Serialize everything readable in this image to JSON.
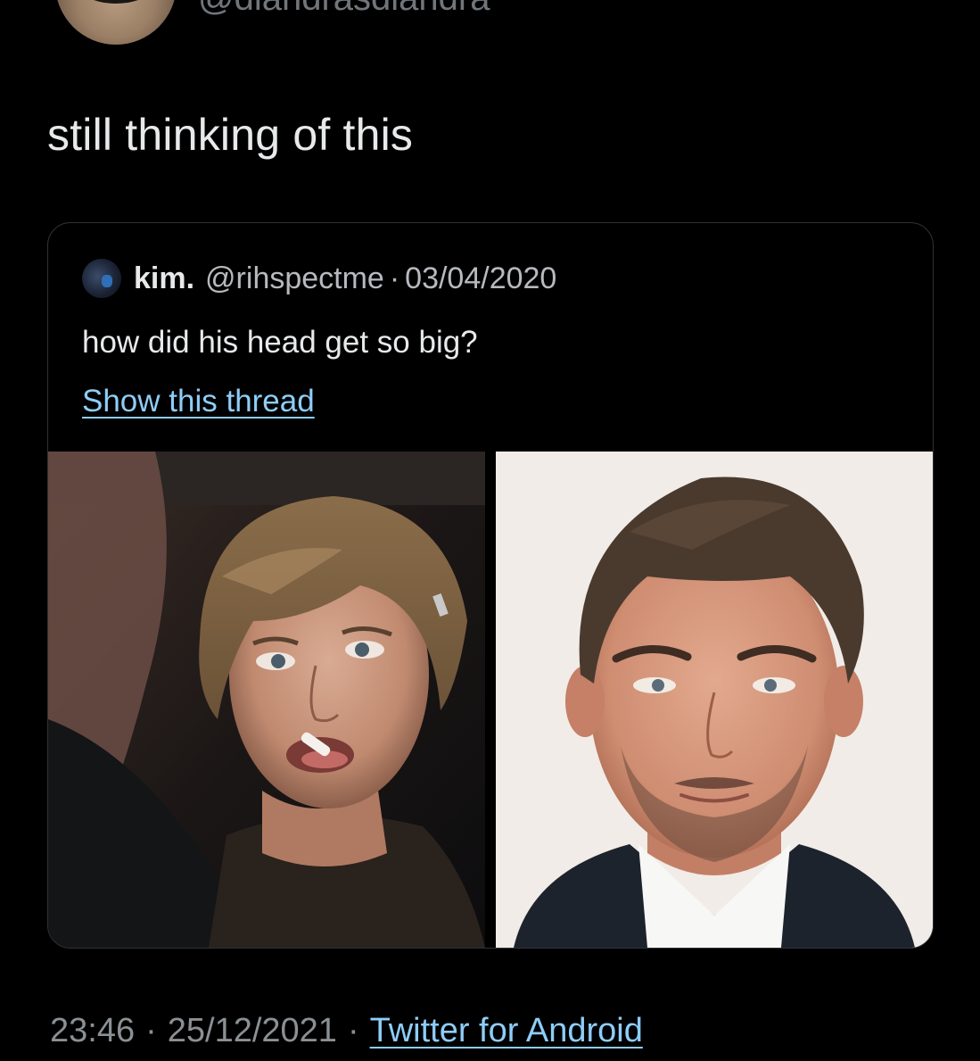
{
  "author": {
    "handle": "@diandrasdiandra",
    "avatar_icon": "user-avatar"
  },
  "tweet": {
    "text": "still thinking of this"
  },
  "quoted_tweet": {
    "name": "kim.",
    "handle": "@rihspectme",
    "separator": "·",
    "date": "03/04/2020",
    "text": "how did his head get so big?",
    "thread_link": "Show this thread",
    "media": [
      {
        "icon": "photo-young-man-with-cigarette"
      },
      {
        "icon": "photo-older-man-in-suit"
      }
    ]
  },
  "footer": {
    "time": "23:46",
    "separator": "·",
    "date": "25/12/2021",
    "source": "Twitter for Android"
  },
  "colors": {
    "background": "#000000",
    "text": "#e7e9ea",
    "muted": "#8b9094",
    "link": "#8ecdf8",
    "border": "#2f3336"
  }
}
